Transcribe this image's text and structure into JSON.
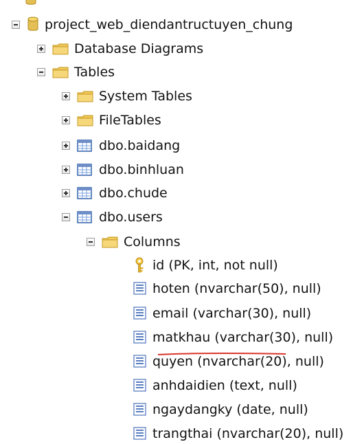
{
  "tree": {
    "partial_top_label": "",
    "database": {
      "label": "project_web_diendantructuyen_chung",
      "expanded": true
    },
    "nodes": [
      {
        "label": "Database Diagrams",
        "expanded": false,
        "icon": "folder-icon"
      },
      {
        "label": "Tables",
        "expanded": true,
        "icon": "folder-icon"
      },
      {
        "label": "System Tables",
        "expanded": false,
        "icon": "folder-icon"
      },
      {
        "label": "FileTables",
        "expanded": false,
        "icon": "folder-icon"
      },
      {
        "label": "dbo.baidang",
        "expanded": false,
        "icon": "table-icon"
      },
      {
        "label": "dbo.binhluan",
        "expanded": false,
        "icon": "table-icon"
      },
      {
        "label": "dbo.chude",
        "expanded": false,
        "icon": "table-icon"
      },
      {
        "label": "dbo.users",
        "expanded": true,
        "icon": "table-icon"
      },
      {
        "label": "Columns",
        "expanded": true,
        "icon": "folder-icon"
      }
    ],
    "columns": [
      {
        "label": "id (PK, int, not null)",
        "icon": "key-icon"
      },
      {
        "label": "hoten (nvarchar(50), null)",
        "icon": "column-icon"
      },
      {
        "label": "email (varchar(30), null)",
        "icon": "column-icon"
      },
      {
        "label": "matkhau (varchar(30), null)",
        "icon": "column-icon"
      },
      {
        "label": "quyen (nvarchar(20), null)",
        "icon": "column-icon"
      },
      {
        "label": "anhdaidien (text, null)",
        "icon": "column-icon"
      },
      {
        "label": "ngaydangky (date, null)",
        "icon": "column-icon"
      },
      {
        "label": "trangthai (nvarchar(20), null)",
        "icon": "column-icon"
      }
    ]
  },
  "colors": {
    "folder": "#f1cf63",
    "database": "#e4bf55",
    "table": "#6f8ec9",
    "underline": "#d9342a"
  }
}
